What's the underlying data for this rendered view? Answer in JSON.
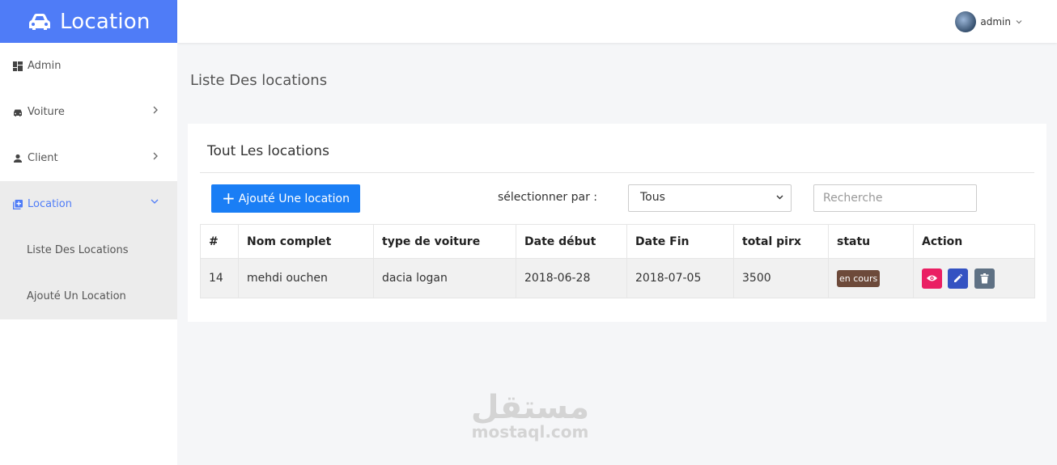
{
  "app": {
    "brand_title": "Location",
    "brand_icon": "car-icon"
  },
  "topbar": {
    "username": "admin"
  },
  "sidebar": {
    "items": [
      {
        "label": "Admin",
        "icon": "dashboard-icon"
      },
      {
        "label": "Voiture",
        "icon": "car-icon"
      },
      {
        "label": "Client",
        "icon": "person-icon"
      },
      {
        "label": "Location",
        "icon": "add-box-icon"
      }
    ],
    "subitems": [
      {
        "label": "Liste Des Locations"
      },
      {
        "label": "Ajouté Un Location"
      }
    ]
  },
  "main": {
    "page_title": "Liste Des locations",
    "card_title": "Tout Les locations",
    "add_button": "Ajouté Une location",
    "filter_label": "sélectionner par :",
    "filter_selected": "Tous",
    "search_placeholder": "Recherche"
  },
  "table": {
    "headers": [
      "#",
      "Nom complet",
      "type de voiture",
      "Date début",
      "Date Fin",
      "total pirx",
      "statu",
      "Action"
    ],
    "rows": [
      {
        "id": "14",
        "nom": "mehdi ouchen",
        "voiture": "dacia logan",
        "debut": "2018-06-28",
        "fin": "2018-07-05",
        "total": "3500",
        "statu": "en cours"
      }
    ]
  },
  "watermark": {
    "arabic": "مستقل",
    "latin": "mostaql.com"
  },
  "colors": {
    "accent": "#4f7cf7",
    "primary_button": "#1a7ef5",
    "badge": "#6d4a3a",
    "view": "#ea1f63",
    "edit": "#3452c2",
    "delete": "#5f7184"
  }
}
